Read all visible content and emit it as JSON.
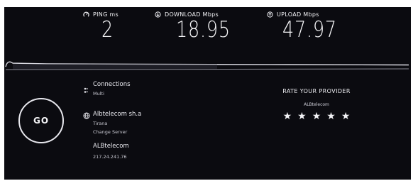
{
  "caption": "",
  "metrics": [
    {
      "label": "PING ms",
      "value": "2",
      "icon": "ping-icon"
    },
    {
      "label": "DOWNLOAD Mbps",
      "value": "18.95",
      "icon": "download-icon"
    },
    {
      "label": "UPLOAD Mbps",
      "value": "47.97",
      "icon": "upload-icon"
    }
  ],
  "go_label": "GO",
  "connections": {
    "label": "Connections",
    "value": "Multi"
  },
  "server": {
    "name": "Albtelecom sh.a",
    "location": "Tirana",
    "change_label": "Change Server"
  },
  "provider": {
    "name": "ALBtelecom",
    "ip": "217.24.241.76"
  },
  "rate": {
    "title": "RATE YOUR PROVIDER",
    "subtitle": "ALBtelecom",
    "stars": [
      "★",
      "★",
      "★",
      "★",
      "★"
    ]
  }
}
